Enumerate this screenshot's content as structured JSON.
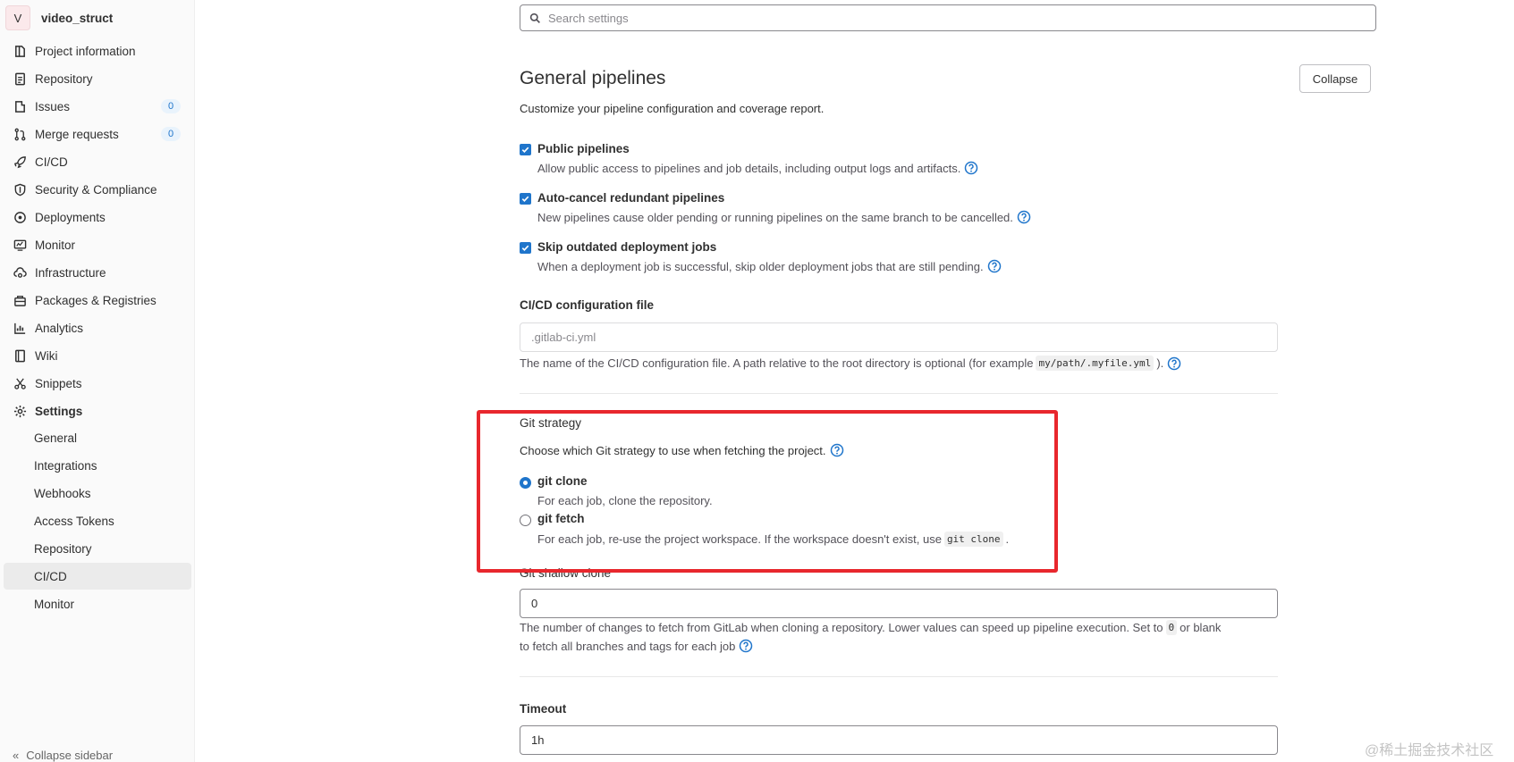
{
  "sidebar": {
    "project": {
      "avatar_letter": "V",
      "name": "video_struct"
    },
    "items": [
      {
        "label": "Project information",
        "icon": "project-icon"
      },
      {
        "label": "Repository",
        "icon": "doc-icon"
      },
      {
        "label": "Issues",
        "icon": "issues-icon",
        "badge": "0"
      },
      {
        "label": "Merge requests",
        "icon": "merge-request-icon",
        "badge": "0"
      },
      {
        "label": "CI/CD",
        "icon": "rocket-icon"
      },
      {
        "label": "Security & Compliance",
        "icon": "shield-icon"
      },
      {
        "label": "Deployments",
        "icon": "deployments-icon"
      },
      {
        "label": "Monitor",
        "icon": "monitor-icon"
      },
      {
        "label": "Infrastructure",
        "icon": "cloud-gear-icon"
      },
      {
        "label": "Packages & Registries",
        "icon": "package-icon"
      },
      {
        "label": "Analytics",
        "icon": "chart-icon"
      },
      {
        "label": "Wiki",
        "icon": "book-icon"
      },
      {
        "label": "Snippets",
        "icon": "scissors-icon"
      },
      {
        "label": "Settings",
        "icon": "gear-icon"
      }
    ],
    "settings_sub": [
      "General",
      "Integrations",
      "Webhooks",
      "Access Tokens",
      "Repository",
      "CI/CD",
      "Monitor"
    ],
    "active_sub": "CI/CD",
    "collapse_label": "Collapse sidebar"
  },
  "search": {
    "placeholder": "Search settings"
  },
  "section": {
    "title": "General pipelines",
    "collapse_label": "Collapse",
    "description": "Customize your pipeline configuration and coverage report."
  },
  "checkboxes": [
    {
      "label": "Public pipelines",
      "help": "Allow public access to pipelines and job details, including output logs and artifacts.",
      "checked": true
    },
    {
      "label": "Auto-cancel redundant pipelines",
      "help": "New pipelines cause older pending or running pipelines on the same branch to be cancelled.",
      "checked": true
    },
    {
      "label": "Skip outdated deployment jobs",
      "help": "When a deployment job is successful, skip older deployment jobs that are still pending.",
      "checked": true
    }
  ],
  "ci_config": {
    "label": "CI/CD configuration file",
    "placeholder": ".gitlab-ci.yml",
    "help_before": "The name of the CI/CD configuration file. A path relative to the root directory is optional (for example",
    "help_code": "my/path/.myfile.yml",
    "help_after": ")."
  },
  "git_strategy": {
    "label": "Git strategy",
    "description": "Choose which Git strategy to use when fetching the project.",
    "options": [
      {
        "label": "git clone",
        "help": "For each job, clone the repository.",
        "selected": true
      },
      {
        "label": "git fetch",
        "help": "For each job, re-use the project workspace. If the workspace doesn't exist, use",
        "code": "git clone",
        "help_after": ".",
        "selected": false
      }
    ]
  },
  "shallow_clone": {
    "label": "Git shallow clone",
    "value": "0",
    "help_line1_before": "The number of changes to fetch from GitLab when cloning a repository. Lower values can speed up pipeline execution. Set to",
    "help_code": "0",
    "help_line1_after": "or blank",
    "help_line2": "to fetch all branches and tags for each job"
  },
  "timeout": {
    "label": "Timeout",
    "value": "1h"
  },
  "watermark": "@稀土掘金技术社区",
  "colors": {
    "accent": "#1f75cb",
    "highlight": "#e8272d"
  }
}
